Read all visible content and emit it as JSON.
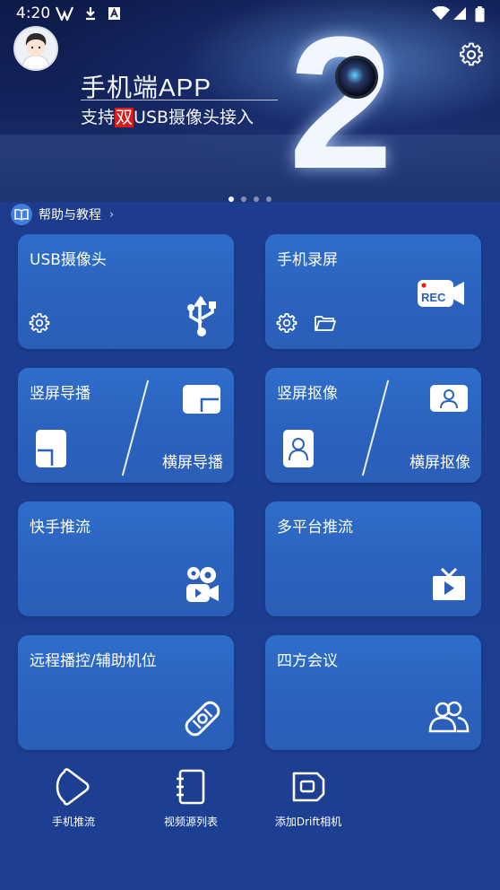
{
  "status_bar": {
    "time": "4:20"
  },
  "banner": {
    "title_line1": "手机端APP",
    "title_line2_prefix": "支持",
    "title_line2_highlight": "双",
    "title_line2_suffix": "USB摄像头接入",
    "big_number": "2",
    "carousel_total": 4,
    "carousel_active": 1
  },
  "help": {
    "label": "帮助与教程"
  },
  "tiles": [
    {
      "label": "USB摄像头"
    },
    {
      "label": "手机录屏",
      "rec_badge": "REC"
    },
    {
      "label": "竖屏导播",
      "sub_label": "横屏导播"
    },
    {
      "label": "竖屏抠像",
      "sub_label": "横屏抠像"
    },
    {
      "label": "快手推流"
    },
    {
      "label": "多平台推流"
    },
    {
      "label": "远程播控/辅助机位"
    },
    {
      "label": "四方会议"
    }
  ],
  "bottom_nav": [
    {
      "label": "手机推流"
    },
    {
      "label": "视频源列表"
    },
    {
      "label": "添加Drift相机"
    }
  ],
  "colors": {
    "tile": "#2e6ecb",
    "background": "#1e3a8a",
    "highlight": "#d61c1c"
  }
}
